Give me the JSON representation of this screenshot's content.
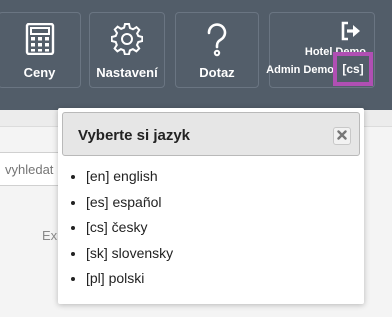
{
  "header": {
    "tiles": [
      {
        "label": "Ceny",
        "icon": "calculator-icon"
      },
      {
        "label": "Nastavení",
        "icon": "gear-icon"
      },
      {
        "label": "Dotaz",
        "icon": "question-icon"
      }
    ],
    "user": {
      "hotel_name": "Hotel Demo",
      "admin_name": "Admin Demo",
      "language_button": "[cs]",
      "logout_icon": "logout-icon"
    },
    "colors": {
      "bar": "#525d69",
      "highlight": "#b04fb3"
    }
  },
  "page": {
    "search_placeholder": "vyhledat",
    "partial_text": "Ex"
  },
  "language_modal": {
    "title": "Vyberte si jazyk",
    "close_icon": "close-icon",
    "languages": [
      {
        "label": "[en] english"
      },
      {
        "label": "[es] español"
      },
      {
        "label": "[cs] česky"
      },
      {
        "label": "[sk] slovensky"
      },
      {
        "label": "[pl] polski"
      }
    ]
  }
}
